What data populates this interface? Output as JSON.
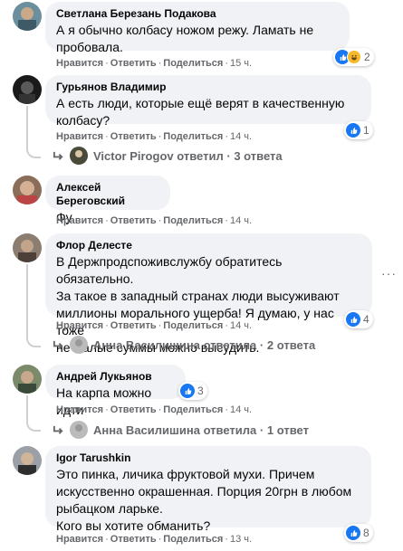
{
  "actions": {
    "like": "Нравится",
    "reply": "Ответить",
    "share": "Поделиться",
    "dot": "·"
  },
  "comments": [
    {
      "author": "Светлана Березань Подакова",
      "text": "А я обычно колбасу ножом режу. Ламать не\nпробовала.",
      "time": "15 ч.",
      "reactions": "2",
      "reaction_icons": [
        "like-icon",
        "haha-icon"
      ]
    },
    {
      "author": "Гурьянов Владимир",
      "text": "А есть люди, которые ещё верят в качественную\nколбасу?",
      "time": "14 ч.",
      "reactions": "1",
      "replies": {
        "name": "Victor Pirogov",
        "verb": "ответил",
        "count": "3 ответа"
      }
    },
    {
      "author": "Алексей Береговский",
      "text": "Фу",
      "time": "14 ч."
    },
    {
      "author": "Флор Делесте",
      "text": "В Держпродспоживслужбу обратитесь обязательно.\nЗа такое в западный странах люди высуживают\nмиллионы морального ущерба! Я думаю, у нас тоже\nне малые суммы можно высудить.",
      "time": "14 ч.",
      "reactions": "4",
      "replies": {
        "name": "Анна Василишина",
        "verb": "ответила",
        "count": "2 ответа"
      },
      "more": "···"
    },
    {
      "author": "Андрей Лукьянов",
      "text": "На карпа можно идти",
      "time": "14 ч.",
      "reactions": "3",
      "replies": {
        "name": "Анна Василишина",
        "verb": "ответила",
        "count": "1 ответ"
      }
    },
    {
      "author": "Igor Tarushkin",
      "text": "Это пинка, личика фруктовой мухи. Причем\nискусственно окрашенная. Порция 20грн в любом\nрыбацком ларьке.\nКого вы хотите обманить?",
      "time": "13 ч.",
      "reactions": "8"
    }
  ],
  "colors": {
    "bubble": "#f0f2f5",
    "like": "#1877f2",
    "meta": "#65676b"
  }
}
